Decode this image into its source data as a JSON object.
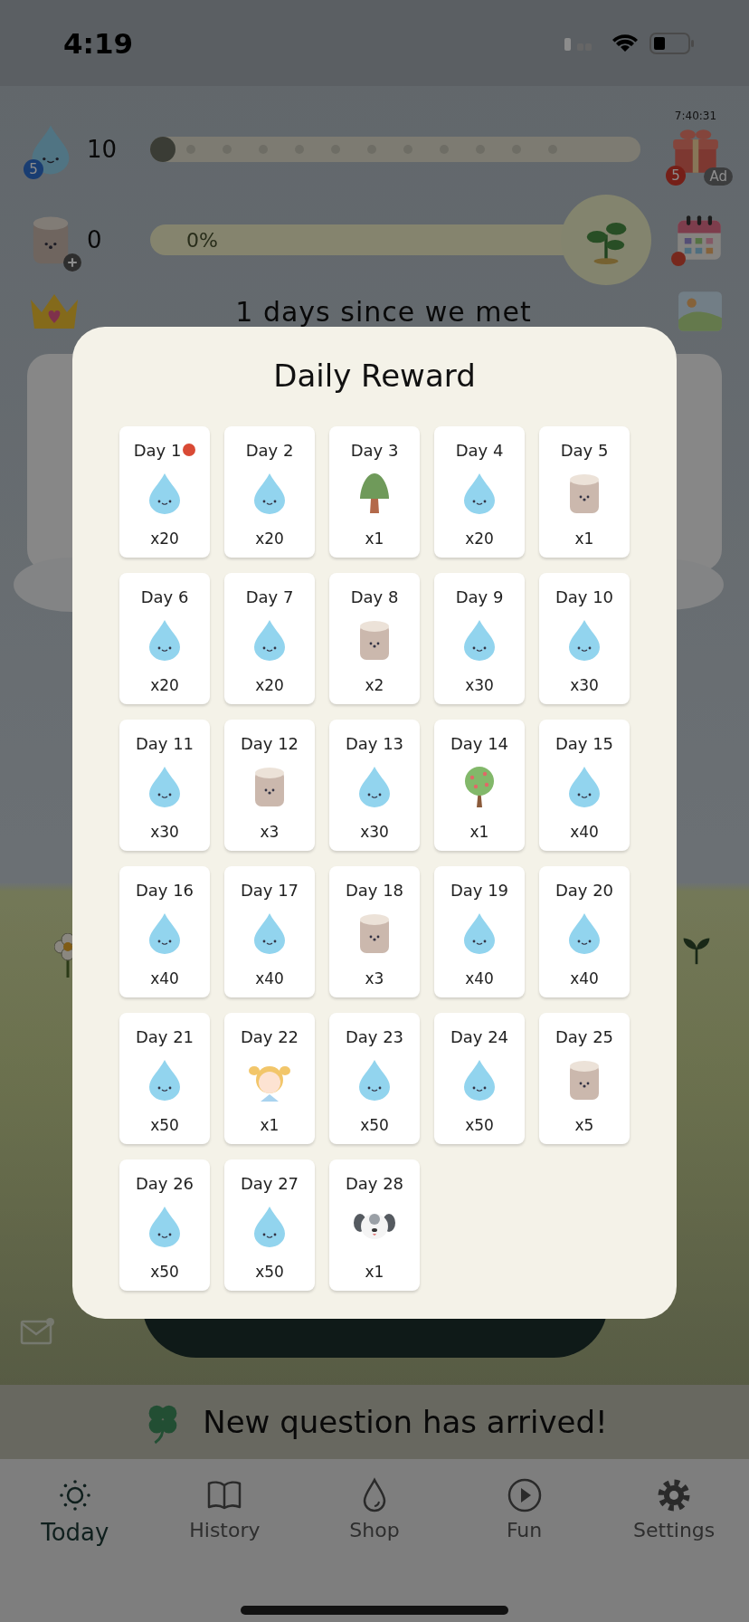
{
  "status_bar": {
    "time": "4:19"
  },
  "stats": {
    "water": {
      "count": "10",
      "badge": "5"
    },
    "growth": {
      "level": 0
    },
    "gift": {
      "timer": "7:40:31",
      "badge": "5",
      "ad": "Ad"
    },
    "wood": {
      "count": "0"
    },
    "progress": {
      "label": "0%"
    },
    "calendar": {
      "alert": true
    },
    "days_text": "1 days since we met"
  },
  "mail": {
    "unread": true
  },
  "modal": {
    "title": "Daily Reward",
    "days": [
      {
        "label": "Day 1",
        "kind": "water",
        "amount": "x20",
        "alert": true
      },
      {
        "label": "Day 2",
        "kind": "water",
        "amount": "x20",
        "alert": false
      },
      {
        "label": "Day 3",
        "kind": "tree",
        "amount": "x1",
        "alert": false
      },
      {
        "label": "Day 4",
        "kind": "water",
        "amount": "x20",
        "alert": false
      },
      {
        "label": "Day 5",
        "kind": "log",
        "amount": "x1",
        "alert": false
      },
      {
        "label": "Day 6",
        "kind": "water",
        "amount": "x20",
        "alert": false
      },
      {
        "label": "Day 7",
        "kind": "water",
        "amount": "x20",
        "alert": false
      },
      {
        "label": "Day 8",
        "kind": "log",
        "amount": "x2",
        "alert": false
      },
      {
        "label": "Day 9",
        "kind": "water",
        "amount": "x30",
        "alert": false
      },
      {
        "label": "Day 10",
        "kind": "water",
        "amount": "x30",
        "alert": false
      },
      {
        "label": "Day 11",
        "kind": "water",
        "amount": "x30",
        "alert": false
      },
      {
        "label": "Day 12",
        "kind": "log",
        "amount": "x3",
        "alert": false
      },
      {
        "label": "Day 13",
        "kind": "water",
        "amount": "x30",
        "alert": false
      },
      {
        "label": "Day 14",
        "kind": "fruit_tree",
        "amount": "x1",
        "alert": false
      },
      {
        "label": "Day 15",
        "kind": "water",
        "amount": "x40",
        "alert": false
      },
      {
        "label": "Day 16",
        "kind": "water",
        "amount": "x40",
        "alert": false
      },
      {
        "label": "Day 17",
        "kind": "water",
        "amount": "x40",
        "alert": false
      },
      {
        "label": "Day 18",
        "kind": "log",
        "amount": "x3",
        "alert": false
      },
      {
        "label": "Day 19",
        "kind": "water",
        "amount": "x40",
        "alert": false
      },
      {
        "label": "Day 20",
        "kind": "water",
        "amount": "x40",
        "alert": false
      },
      {
        "label": "Day 21",
        "kind": "water",
        "amount": "x50",
        "alert": false
      },
      {
        "label": "Day 22",
        "kind": "girl",
        "amount": "x1",
        "alert": false
      },
      {
        "label": "Day 23",
        "kind": "water",
        "amount": "x50",
        "alert": false
      },
      {
        "label": "Day 24",
        "kind": "water",
        "amount": "x50",
        "alert": false
      },
      {
        "label": "Day 25",
        "kind": "log",
        "amount": "x5",
        "alert": false
      },
      {
        "label": "Day 26",
        "kind": "water",
        "amount": "x50",
        "alert": false
      },
      {
        "label": "Day 27",
        "kind": "water",
        "amount": "x50",
        "alert": false
      },
      {
        "label": "Day 28",
        "kind": "dog",
        "amount": "x1",
        "alert": false
      }
    ]
  },
  "banner": {
    "text": "New question has arrived!"
  },
  "tabs": [
    {
      "label": "Today",
      "kind": "sun",
      "selected": true
    },
    {
      "label": "History",
      "kind": "book",
      "selected": false
    },
    {
      "label": "Shop",
      "kind": "drop",
      "selected": false
    },
    {
      "label": "Fun",
      "kind": "play",
      "selected": false
    },
    {
      "label": "Settings",
      "kind": "gear",
      "selected": false
    }
  ]
}
